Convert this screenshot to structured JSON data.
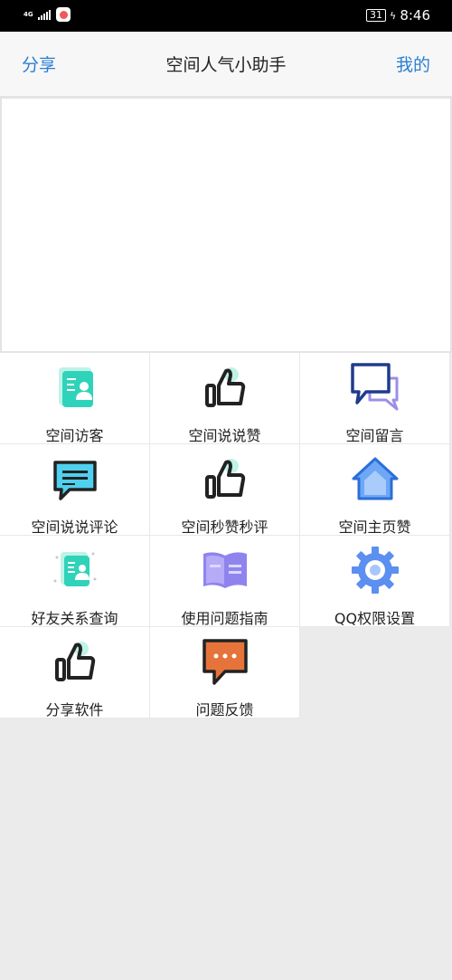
{
  "status_bar": {
    "network": "4G",
    "battery": "31",
    "time": "8:46"
  },
  "header": {
    "share_label": "分享",
    "title": "空间人气小助手",
    "mine_label": "我的"
  },
  "grid_items": [
    {
      "label": "空间访客",
      "icon": "visitor-card-icon"
    },
    {
      "label": "空间说说赞",
      "icon": "thumbs-up-icon"
    },
    {
      "label": "空间留言",
      "icon": "chat-bubbles-icon"
    },
    {
      "label": "空间说说评论",
      "icon": "comment-icon"
    },
    {
      "label": "空间秒赞秒评",
      "icon": "thumbs-up-icon"
    },
    {
      "label": "空间主页赞",
      "icon": "home-icon"
    },
    {
      "label": "好友关系查询",
      "icon": "friend-card-icon"
    },
    {
      "label": "使用问题指南",
      "icon": "book-icon"
    },
    {
      "label": "QQ权限设置",
      "icon": "gear-icon"
    },
    {
      "label": "分享软件",
      "icon": "thumbs-up-icon"
    },
    {
      "label": "问题反馈",
      "icon": "feedback-icon"
    }
  ],
  "colors": {
    "link": "#2a7fd4",
    "teal": "#2fd3b9",
    "page_bg": "#ebebeb"
  }
}
